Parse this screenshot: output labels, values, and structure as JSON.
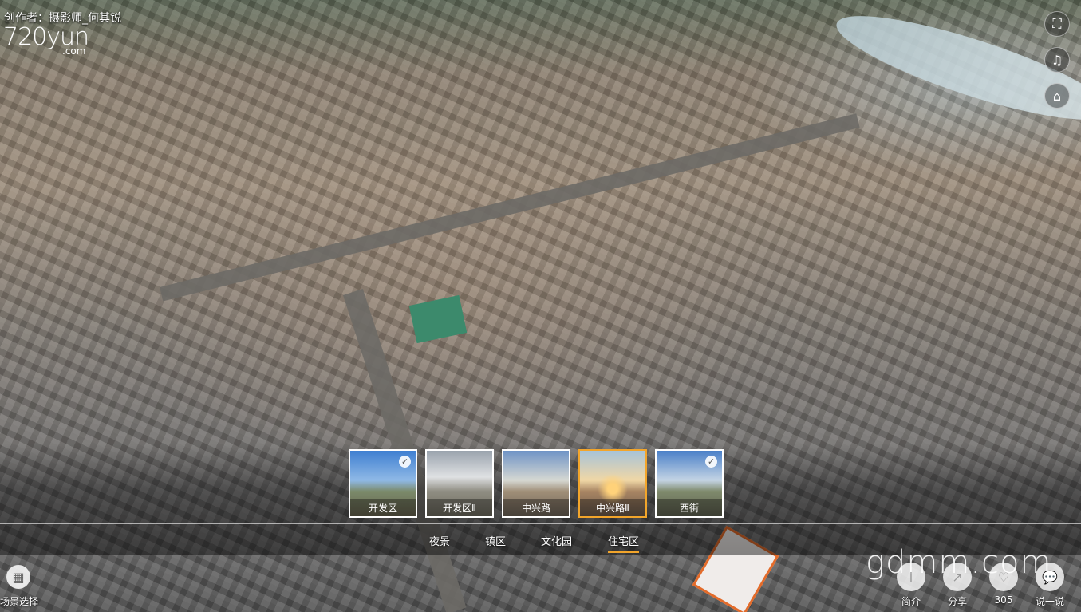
{
  "credit": "创作者：摄影师_何其锐",
  "logo": {
    "main": "720yun",
    "sub": ".com"
  },
  "right_controls": [
    {
      "name": "fullscreen",
      "icon": "⛶"
    },
    {
      "name": "music",
      "icon": "♫"
    },
    {
      "name": "gyro",
      "icon": "⌂"
    }
  ],
  "thumbnails": [
    {
      "label": "开发区",
      "checked": true,
      "active": false
    },
    {
      "label": "开发区Ⅱ",
      "checked": false,
      "active": false
    },
    {
      "label": "中兴路",
      "checked": false,
      "active": false
    },
    {
      "label": "中兴路Ⅱ",
      "checked": false,
      "active": true
    },
    {
      "label": "西街",
      "checked": true,
      "active": false
    }
  ],
  "categories": [
    "夜景",
    "镇区",
    "文化园",
    "住宅区"
  ],
  "active_category": "住宅区",
  "scene_select_label": "场景选择",
  "watermark": "gdmm.com",
  "actions": [
    {
      "label": "简介",
      "icon": "i"
    },
    {
      "label": "分享",
      "icon": "↗"
    },
    {
      "label": "305",
      "icon": "♡"
    },
    {
      "label": "说一说",
      "icon": "💬"
    }
  ]
}
